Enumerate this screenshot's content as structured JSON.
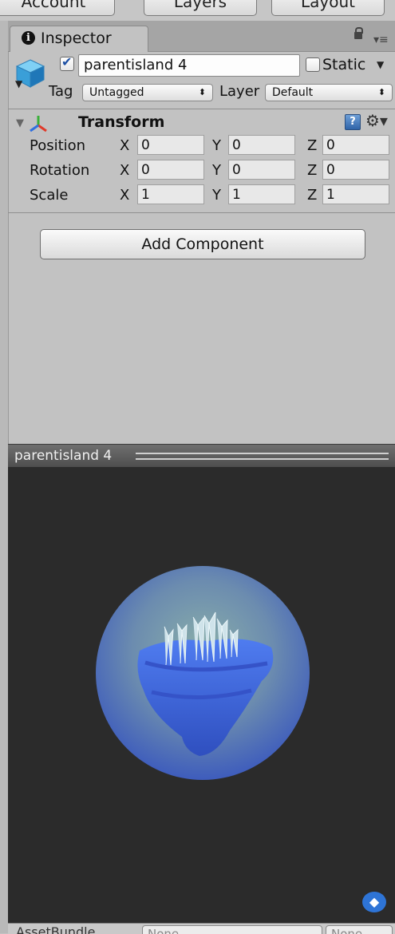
{
  "toolbar": {
    "account_label": "Account",
    "layers_label": "Layers",
    "layout_label": "Layout"
  },
  "tab": {
    "label": "Inspector"
  },
  "object": {
    "name": "parentisland 4",
    "active": true,
    "static_label": "Static",
    "static": false,
    "tag_label": "Tag",
    "tag_value": "Untagged",
    "layer_label": "Layer",
    "layer_value": "Default"
  },
  "transform": {
    "title": "Transform",
    "rows": [
      {
        "label": "Position",
        "x": "0",
        "y": "0",
        "z": "0"
      },
      {
        "label": "Rotation",
        "x": "0",
        "y": "0",
        "z": "0"
      },
      {
        "label": "Scale",
        "x": "1",
        "y": "1",
        "z": "1"
      }
    ],
    "axis_x": "X",
    "axis_y": "Y",
    "axis_z": "Z"
  },
  "add_component_label": "Add Component",
  "preview": {
    "title": "parentisland 4"
  },
  "assetbundle": {
    "label": "AssetBundle",
    "value": "None",
    "variant": "None"
  },
  "colors": {
    "panel": "#c2c2c2",
    "preview_bg": "#2b2b2b",
    "accent": "#2e74d6"
  }
}
